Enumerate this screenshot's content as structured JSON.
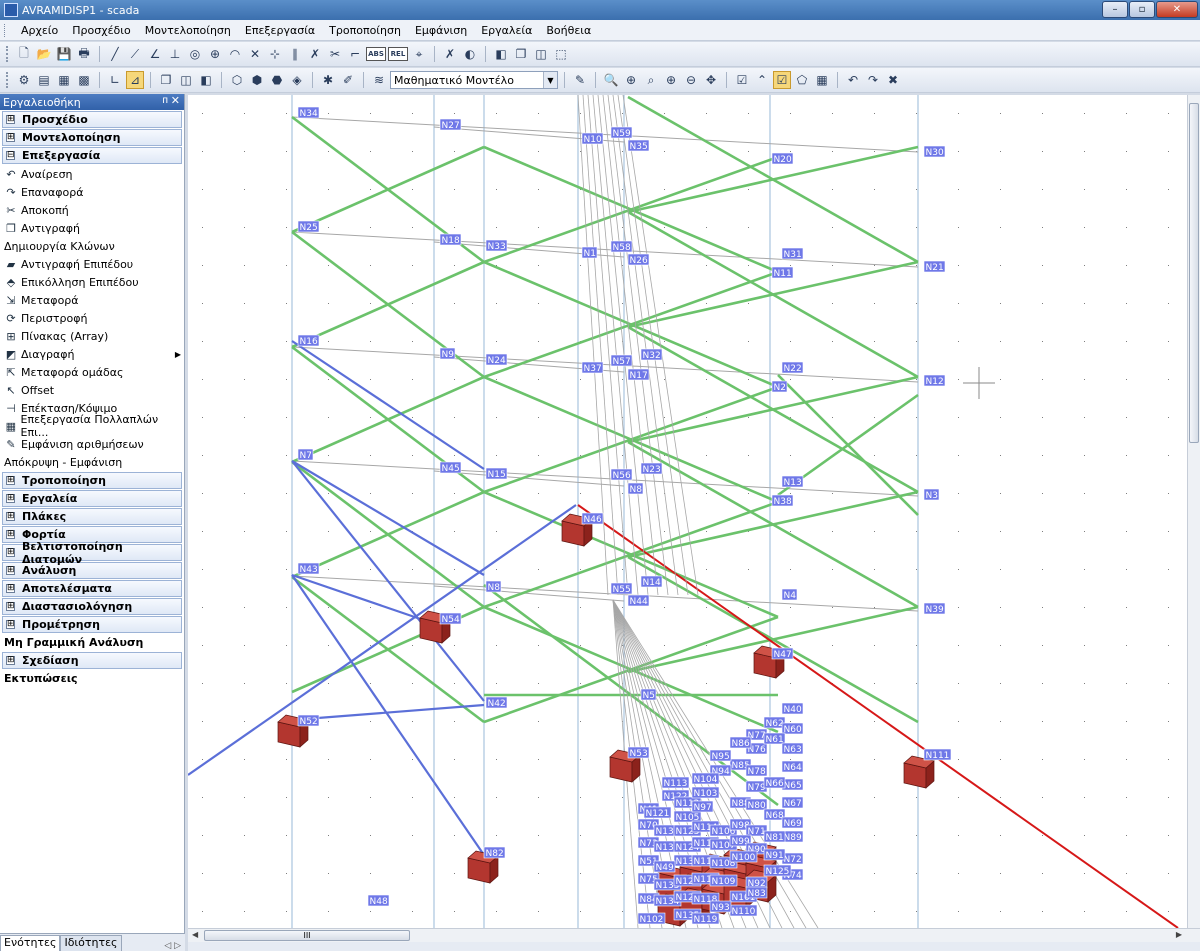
{
  "window": {
    "title": "AVRAMIDISP1 - scada"
  },
  "window_buttons": {
    "minimize": "–",
    "maximize": "▫",
    "close": "✕"
  },
  "menu": [
    "Αρχείο",
    "Προσχέδιο",
    "Μοντελοποίηση",
    "Επεξεργασία",
    "Τροποποίηση",
    "Εμφάνιση",
    "Εργαλεία",
    "Βοήθεια"
  ],
  "toolbar": {
    "model_combo": "Μαθηματικό Μοντέλο",
    "abs_label": "ABS",
    "rel_label": "REL"
  },
  "panel": {
    "title": "Εργαλειοθήκη",
    "pin": "ᴨ",
    "close": "✕",
    "collapsed_marker": "⊟",
    "expanded_marker": "⊞",
    "sections_top": [
      {
        "label": "Προσχέδιο",
        "expanded": false
      },
      {
        "label": "Μοντελοποίηση",
        "expanded": false
      },
      {
        "label": "Επεξεργασία",
        "expanded": true
      }
    ],
    "edit_items": [
      {
        "label": "Αναίρεση",
        "icon": "undo-icon",
        "glyph": "↶"
      },
      {
        "label": "Επαναφορά",
        "icon": "redo-icon",
        "glyph": "↷"
      },
      {
        "label": "Αποκοπή",
        "icon": "scissors-icon",
        "glyph": "✂"
      },
      {
        "label": "Αντιγραφή",
        "icon": "copy-icon",
        "glyph": "❐"
      },
      {
        "label": "Δημιουργία Κλώνων",
        "icon": "",
        "glyph": ""
      },
      {
        "label": "Αντιγραφή Επιπέδου",
        "icon": "copy-level-icon",
        "glyph": "▰"
      },
      {
        "label": "Επικόλληση Επιπέδου",
        "icon": "paste-level-icon",
        "glyph": "⬘"
      },
      {
        "label": "Μεταφορά",
        "icon": "move-icon",
        "glyph": "⇲"
      },
      {
        "label": "Περιστροφή",
        "icon": "rotate-icon",
        "glyph": "⟳"
      },
      {
        "label": "Πίνακας (Array)",
        "icon": "array-icon",
        "glyph": "⊞"
      },
      {
        "label": "Διαγραφή",
        "icon": "eraser-icon",
        "glyph": "◩",
        "submenu": "▶"
      },
      {
        "label": "Μεταφορά ομάδας",
        "icon": "move-group-icon",
        "glyph": "⇱"
      },
      {
        "label": "Offset",
        "icon": "offset-icon",
        "glyph": "↖"
      },
      {
        "label": "Επέκταση/Κόψιμο",
        "icon": "extend-trim-icon",
        "glyph": "⊣"
      },
      {
        "label": "Επεξεργασία Πολλαπλών Επι...",
        "icon": "multi-edit-icon",
        "glyph": "▦"
      },
      {
        "label": "Εμφάνιση αριθμήσεων",
        "icon": "numbering-icon",
        "glyph": "✎"
      },
      {
        "label": "Απόκρυψη - Εμφάνιση",
        "icon": "",
        "glyph": ""
      }
    ],
    "sections_bottom": [
      {
        "label": "Τροποποίηση",
        "boxed": true
      },
      {
        "label": "Εργαλεία",
        "boxed": true
      },
      {
        "label": "Πλάκες",
        "boxed": true
      },
      {
        "label": "Φορτία",
        "boxed": true
      },
      {
        "label": "Βελτιστοποίηση Διατομών",
        "boxed": true
      },
      {
        "label": "Ανάλυση",
        "boxed": true
      },
      {
        "label": "Αποτελέσματα",
        "boxed": true
      },
      {
        "label": "Διαστασιολόγηση",
        "boxed": true
      },
      {
        "label": "Προμέτρηση",
        "boxed": true
      },
      {
        "label": "Μη Γραμμική Ανάλυση",
        "boxed": false
      },
      {
        "label": "Σχεδίαση",
        "boxed": true
      },
      {
        "label": "Εκτυπώσεις",
        "boxed": false
      }
    ],
    "tabs": [
      "Ενότητες",
      "Ιδιότητες"
    ],
    "tab_arrows": "◁ ▷"
  },
  "scrollbar": {
    "h_thumb_grip": "III",
    "left_arrow": "◀",
    "right_arrow": "▶"
  },
  "colors": {
    "green_member": "#6bc26b",
    "blue_member": "#5b6fd8",
    "red_member": "#d61818",
    "grey_member": "#a7a7a7",
    "column": "#a9c4de",
    "node_label_bg": "#6f78e8",
    "support": "#b3362f"
  },
  "node_labels": [
    "N34",
    "N27",
    "N10",
    "N59",
    "N35",
    "N20",
    "N30",
    "N25",
    "N18",
    "N33",
    "N1",
    "N58",
    "N26",
    "N31",
    "N11",
    "N21",
    "N16",
    "N9",
    "N24",
    "N37",
    "N57",
    "N32",
    "N17",
    "N22",
    "N2",
    "N12",
    "N7",
    "N45",
    "N15",
    "N56",
    "N23",
    "N8",
    "N13",
    "N38",
    "N3",
    "N46",
    "N43",
    "N8",
    "N55",
    "N14",
    "N44",
    "N4",
    "N39",
    "N54",
    "N47",
    "N5",
    "N42",
    "N40",
    "N52",
    "N62",
    "N60",
    "N77",
    "N76",
    "N61",
    "N63",
    "N53",
    "N86",
    "N85",
    "N64",
    "N78",
    "N65",
    "N95",
    "N94",
    "N113",
    "N104",
    "N79",
    "N66",
    "N67",
    "N122",
    "N112",
    "N103",
    "N88",
    "N41",
    "N121",
    "N105",
    "N97",
    "N80",
    "N68",
    "N69",
    "N70",
    "N130",
    "N123",
    "N114",
    "N106",
    "N98",
    "N89",
    "N71",
    "N81",
    "N72",
    "N73",
    "N131",
    "N124",
    "N115",
    "N107",
    "N99",
    "N90",
    "N82",
    "N51",
    "N132",
    "N116",
    "N108",
    "N100",
    "N91",
    "N74",
    "N49",
    "N125",
    "N75",
    "N133",
    "N126",
    "N117",
    "N109",
    "N101",
    "N92",
    "N83",
    "N84",
    "N134",
    "N127",
    "N118",
    "N110",
    "N93",
    "N102",
    "N135",
    "N119",
    "N111",
    "N48"
  ]
}
